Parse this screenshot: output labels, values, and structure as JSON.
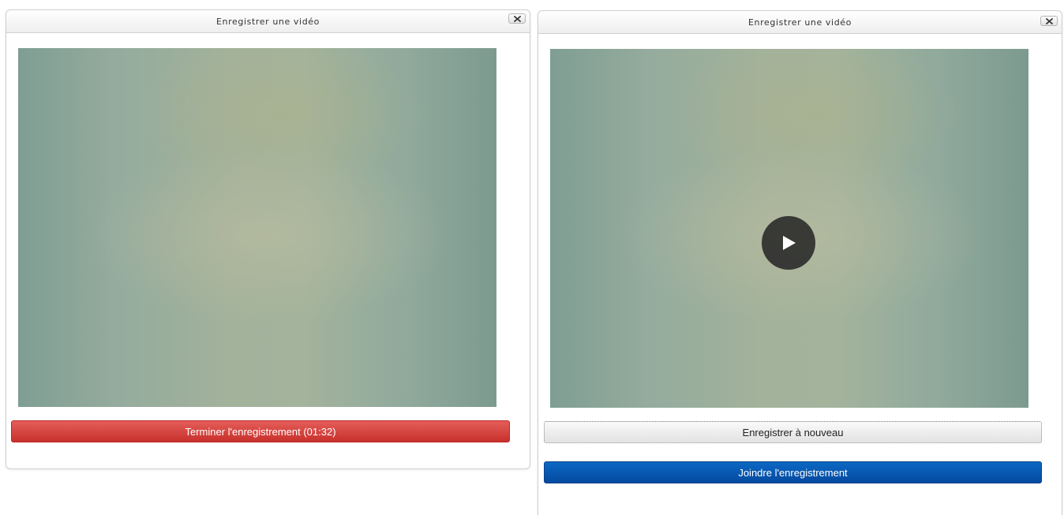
{
  "left_dialog": {
    "title": "Enregistrer une vidéo",
    "close_icon": "close-icon",
    "stop_button_label": "Terminer l'enregistrement (01:32)"
  },
  "right_dialog": {
    "title": "Enregistrer une vidéo",
    "close_icon": "close-icon",
    "play_icon": "play-icon",
    "retry_button_label": "Enregistrer à nouveau",
    "attach_button_label": "Joindre l'enregistrement"
  },
  "colors": {
    "stop_button": "#d9423d",
    "attach_button": "#0556ad",
    "video_tint": "#9fb09c"
  }
}
